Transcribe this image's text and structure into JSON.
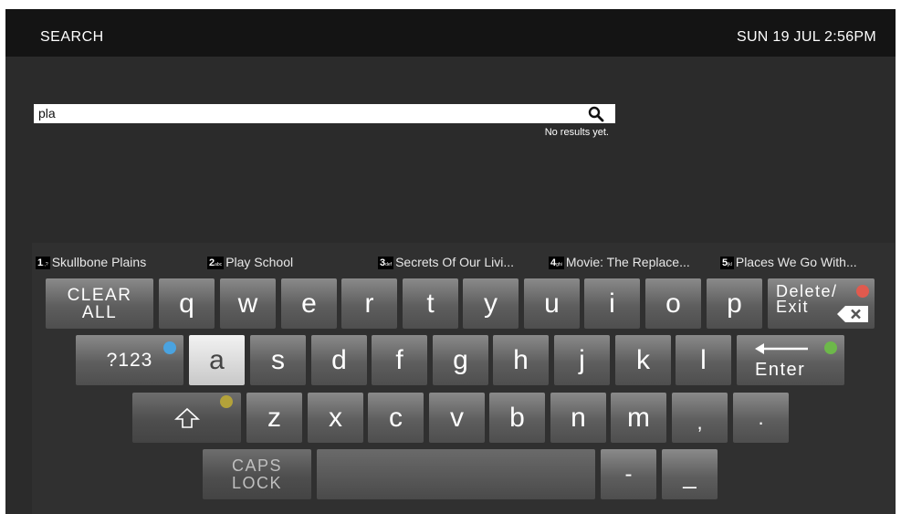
{
  "header": {
    "title": "SEARCH",
    "datetime": "SUN 19 JUL 2:56PM"
  },
  "search": {
    "query": "pla",
    "results_status": "No results yet."
  },
  "suggestions": [
    {
      "num": "1",
      "sub": ".,?",
      "label": "Skullbone Plains"
    },
    {
      "num": "2",
      "sub": "abc",
      "label": "Play School"
    },
    {
      "num": "3",
      "sub": "def",
      "label": "Secrets Of Our Livi..."
    },
    {
      "num": "4",
      "sub": "ghi",
      "label": "Movie: The Replace..."
    },
    {
      "num": "5",
      "sub": "jkl",
      "label": "Places We Go With..."
    }
  ],
  "keyboard": {
    "row1": [
      "q",
      "w",
      "e",
      "r",
      "t",
      "y",
      "u",
      "i",
      "o",
      "p"
    ],
    "row2": [
      "a",
      "s",
      "d",
      "f",
      "g",
      "h",
      "j",
      "k",
      "l"
    ],
    "row3": [
      "z",
      "x",
      "c",
      "v",
      "b",
      "n",
      "m",
      ",",
      "."
    ],
    "clear_all_line1": "CLEAR",
    "clear_all_line2": "ALL",
    "delete_line1": "Delete/",
    "delete_line2": "Exit",
    "symbols": "?123",
    "enter": "Enter",
    "caps_line1": "CAPS",
    "caps_line2": "LOCK",
    "dash": "-",
    "underscore": "_",
    "selected_key": "a"
  },
  "colors": {
    "red_button": "#e05a4e",
    "blue_button": "#4aa3e0",
    "green_button": "#6db84a",
    "yellow_button": "#b3a23a",
    "selected_key": "#e6e6e6"
  }
}
